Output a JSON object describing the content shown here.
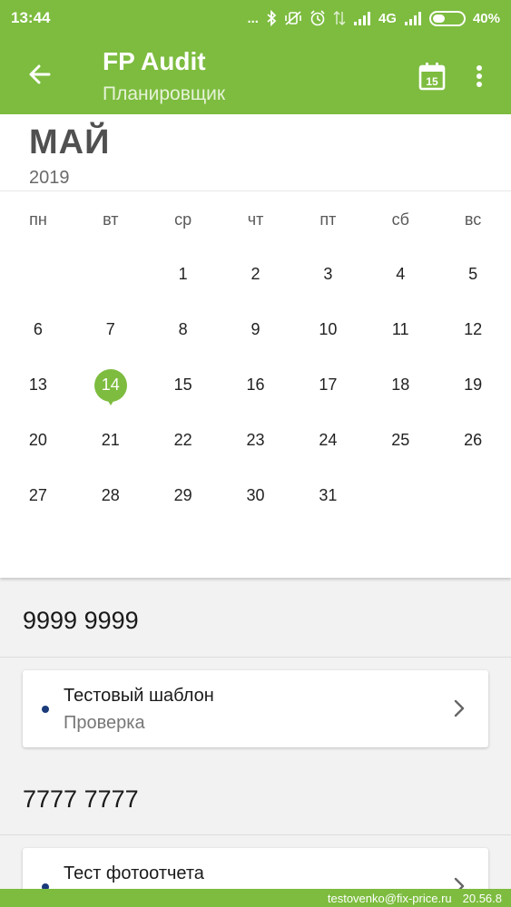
{
  "status_bar": {
    "time": "13:44",
    "dots": "...",
    "network": "4G",
    "battery_text": "40%",
    "battery_level": 0.4,
    "icons": [
      "bluetooth-icon",
      "vibrate-off-icon",
      "alarm-icon",
      "data-icon",
      "signal-icon",
      "signal-icon-2",
      "battery-icon"
    ]
  },
  "app_bar": {
    "title": "FP Audit",
    "subtitle": "Планировщик",
    "calendar_icon_day": "15",
    "icons": [
      "back-arrow-icon",
      "calendar-today-icon",
      "more-vert-icon"
    ]
  },
  "calendar": {
    "month": "МАЙ",
    "year": "2019",
    "weekdays": [
      "пн",
      "вт",
      "ср",
      "чт",
      "пт",
      "сб",
      "вс"
    ],
    "leading_blanks": 2,
    "days": [
      "1",
      "2",
      "3",
      "4",
      "5",
      "6",
      "7",
      "8",
      "9",
      "10",
      "11",
      "12",
      "13",
      "14",
      "15",
      "16",
      "17",
      "18",
      "19",
      "20",
      "21",
      "22",
      "23",
      "24",
      "25",
      "26",
      "27",
      "28",
      "29",
      "30",
      "31"
    ],
    "selected_day": "14",
    "accent": "#7dbc3f"
  },
  "groups": [
    {
      "header": "9999 9999",
      "items": [
        {
          "title": "Тестовый шаблон",
          "subtitle": "Проверка"
        }
      ]
    },
    {
      "header": "7777 7777",
      "items": [
        {
          "title": "Тест фотоотчета",
          "subtitle": ""
        }
      ]
    }
  ],
  "footer": {
    "email": "testovenko@fix-price.ru",
    "version": "20.56.8"
  },
  "colors": {
    "brand": "#7dbc3f",
    "item_dot": "#1a3a7a"
  }
}
